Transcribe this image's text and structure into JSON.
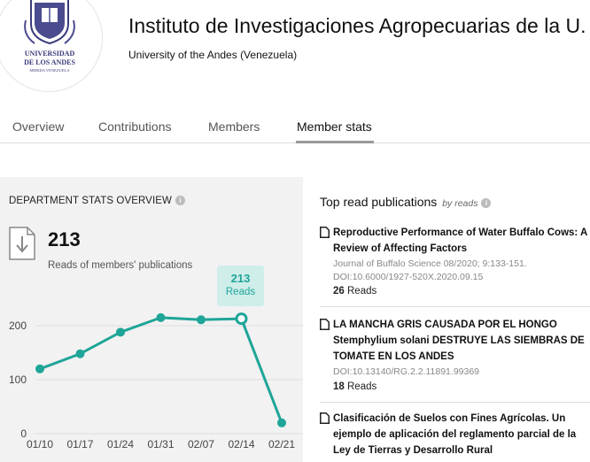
{
  "header": {
    "logo_text_line1": "UNIVERSIDAD",
    "logo_text_line2": "DE LOS ANDES",
    "logo_text_line3": "MERIDA VENEZUELA",
    "title": "Instituto de Investigaciones Agropecuarias de la U...",
    "university": "University of the Andes (Venezuela)"
  },
  "tabs": [
    {
      "label": "Overview",
      "active": false
    },
    {
      "label": "Contributions",
      "active": false
    },
    {
      "label": "Members",
      "active": false
    },
    {
      "label": "Member stats",
      "active": true
    }
  ],
  "stats": {
    "heading": "DEPARTMENT STATS OVERVIEW",
    "total_reads": "213",
    "caption": "Reads of members' publications",
    "tooltip": {
      "value": "213",
      "label": "Reads"
    }
  },
  "chart_data": {
    "type": "line",
    "x": [
      "01/10",
      "01/17",
      "01/24",
      "01/31",
      "02/07",
      "02/14",
      "02/21"
    ],
    "series": [
      {
        "values": [
          120,
          148,
          188,
          215,
          211,
          213,
          20
        ]
      }
    ],
    "ylim": [
      0,
      250
    ],
    "yticks": [
      0,
      100,
      200
    ],
    "grid": true,
    "highlighted_index": 5,
    "color": "#1fa598"
  },
  "publications": {
    "heading": "Top read publications",
    "heading_suffix": "by reads",
    "items": [
      {
        "title": "Reproductive Performance of Water Buffalo Cows: A Review of Affecting Factors",
        "meta": "Journal of Buffalo Science 08/2020; 9:133-151. DOI:10.6000/1927-520X.2020.09.15",
        "reads_count": "26",
        "reads_label": "Reads"
      },
      {
        "title": "LA MANCHA GRIS CAUSADA POR EL HONGO Stemphylium solani DESTRUYE LAS SIEMBRAS DE TOMATE EN LOS ANDES",
        "meta": "DOI:10.13140/RG.2.2.11891.99369",
        "reads_count": "18",
        "reads_label": "Reads"
      },
      {
        "title": "Clasificación de Suelos con Fines Agrícolas. Un ejemplo de aplicación del reglamento parcial de la Ley de Tierras y Desarrollo Rural",
        "meta": "",
        "reads_count": "",
        "reads_label": ""
      }
    ]
  },
  "icons": {
    "info": "info-icon",
    "download": "download-icon",
    "document": "document-icon"
  }
}
